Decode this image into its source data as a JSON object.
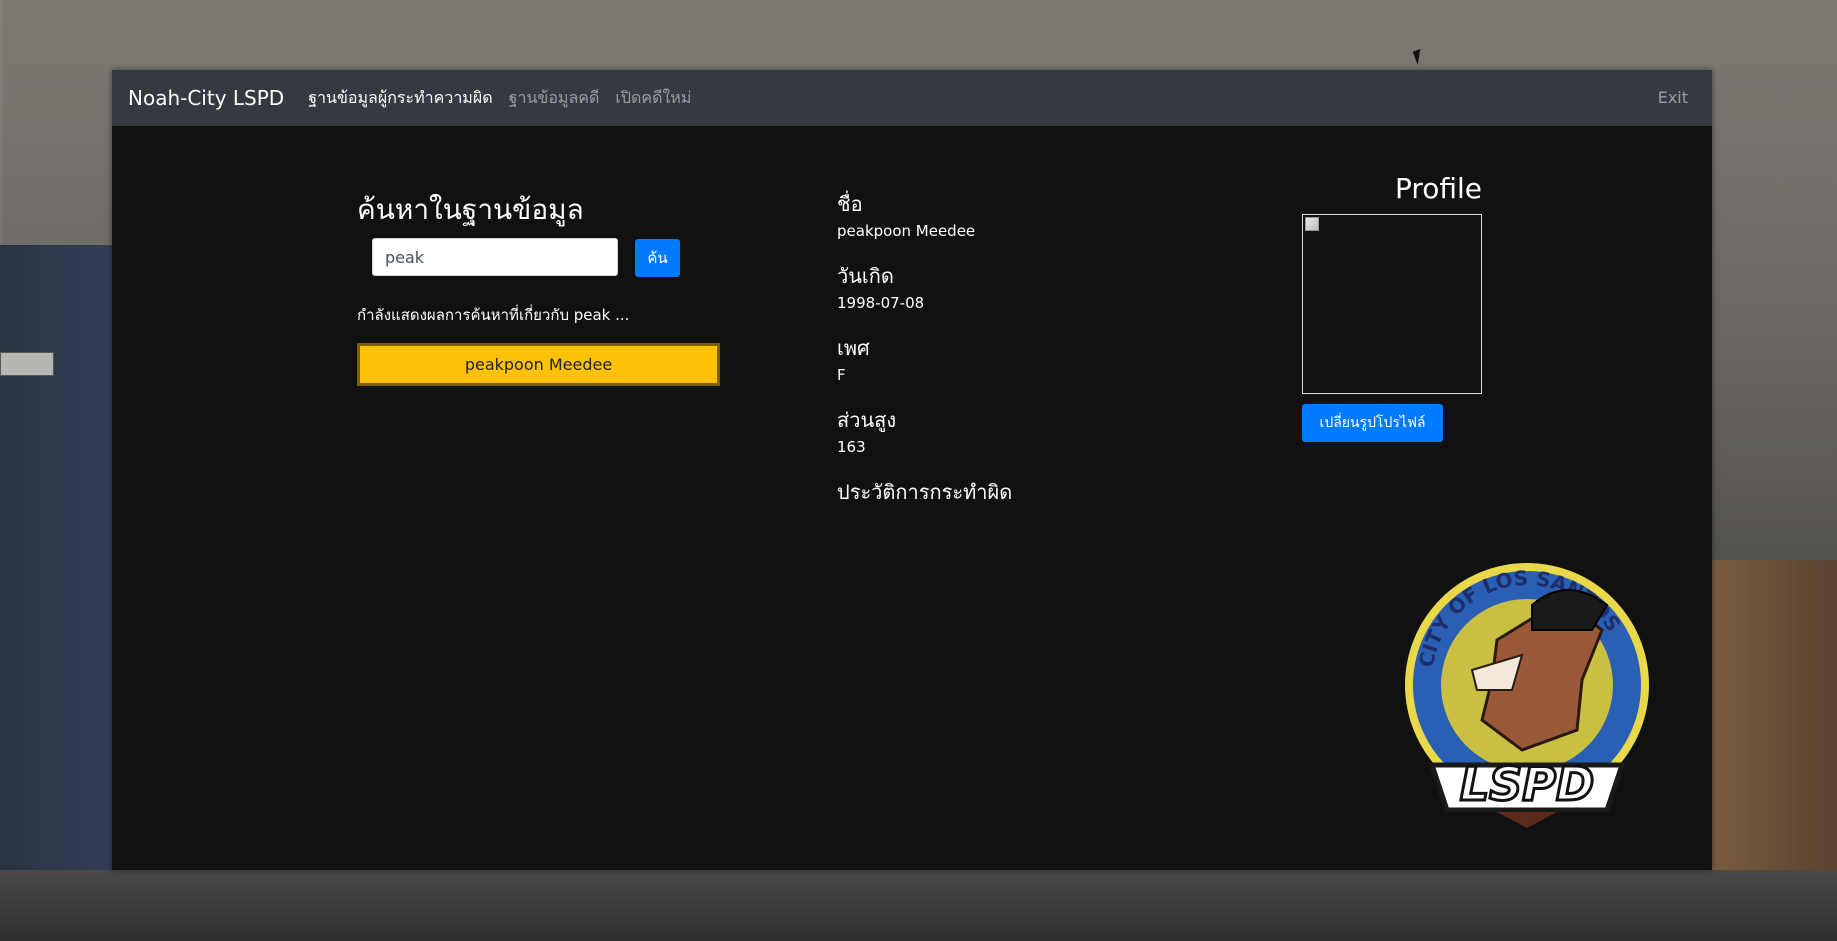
{
  "navbar": {
    "brand": "Noah-City LSPD",
    "links": [
      {
        "label": "ฐานข้อมูลผู้กระทำความผิด",
        "active": true
      },
      {
        "label": "ฐานข้อมูลคดี",
        "active": false
      },
      {
        "label": "เปิดคดีใหม่",
        "active": false
      }
    ],
    "exit_label": "Exit"
  },
  "search": {
    "title": "ค้นหาในฐานข้อมูล",
    "input_value": "peak",
    "button_label": "ค้น",
    "results_text": "กำลังแสดงผลการค้นหาที่เกี่ยวกับ peak ...",
    "results": [
      "peakpoon Meedee"
    ]
  },
  "record": {
    "name_label": "ชื่อ",
    "name_value": "peakpoon Meedee",
    "dob_label": "วันเกิด",
    "dob_value": "1998-07-08",
    "sex_label": "เพศ",
    "sex_value": "F",
    "height_label": "ส่วนสูง",
    "height_value": "163",
    "history_label": "ประวัติการกระทำผิด"
  },
  "profile": {
    "title": "Profile",
    "change_button_label": "เปลี่ยนรูปโปรไฟล์",
    "logo_text_top": "CITY OF LOS SANTOS",
    "logo_text_bottom": "LSPD"
  },
  "colors": {
    "navbar_bg": "#343a40",
    "panel_bg": "#111111",
    "primary": "#007bff",
    "warning": "#ffc107"
  }
}
